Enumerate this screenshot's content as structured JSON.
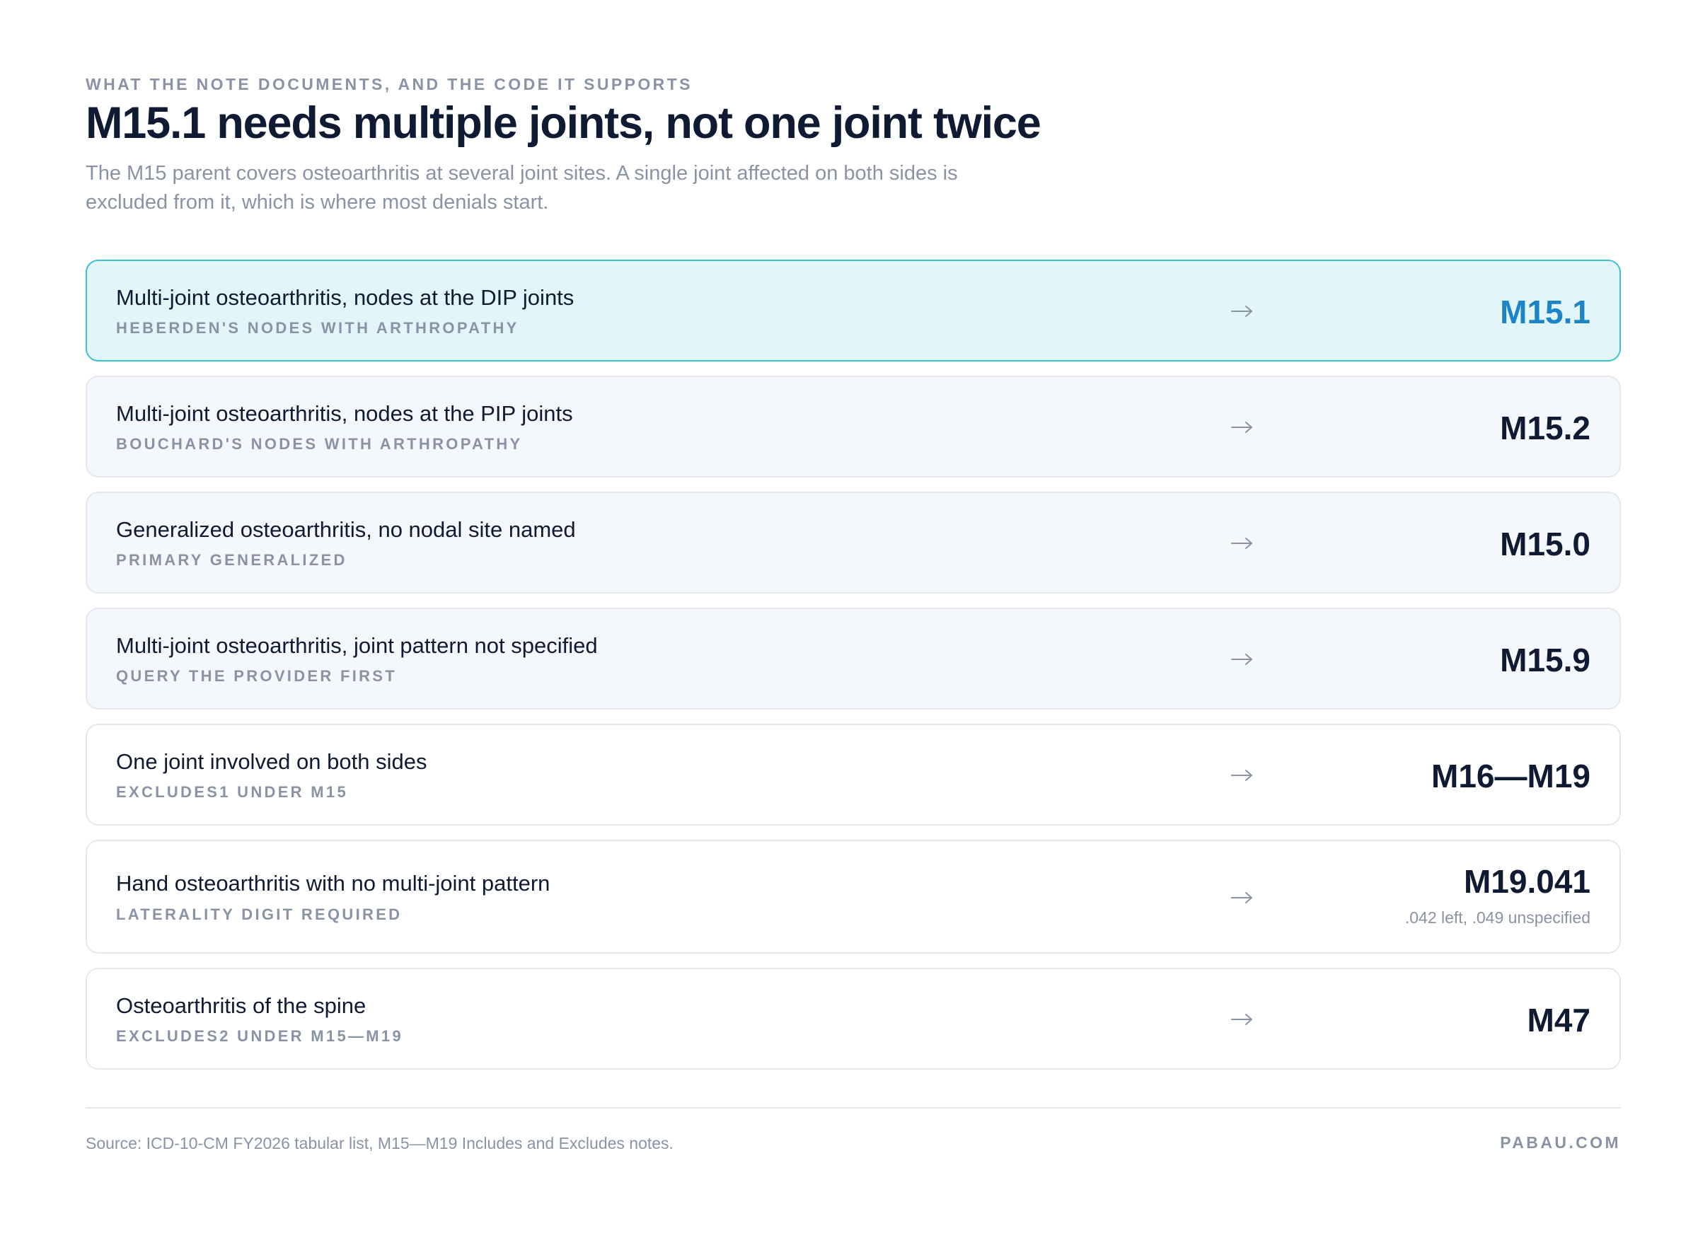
{
  "header": {
    "eyebrow": "WHAT THE NOTE DOCUMENTS, AND THE CODE IT SUPPORTS",
    "title": "M15.1 needs multiple joints, not one joint twice",
    "subtitle": "The M15 parent covers osteoarthritis at several joint sites. A single joint affected on both sides is excluded from it, which is where most denials start."
  },
  "rows": [
    {
      "label": "Multi-joint osteoarthritis, nodes at the DIP joints",
      "sub": "HEBERDEN'S NODES WITH ARTHROPATHY",
      "code": "M15.1",
      "note": "",
      "style": "highlight"
    },
    {
      "label": "Multi-joint osteoarthritis, nodes at the PIP joints",
      "sub": "BOUCHARD'S NODES WITH ARTHROPATHY",
      "code": "M15.2",
      "note": "",
      "style": "tinted"
    },
    {
      "label": "Generalized osteoarthritis, no nodal site named",
      "sub": "PRIMARY GENERALIZED",
      "code": "M15.0",
      "note": "",
      "style": "tinted"
    },
    {
      "label": "Multi-joint osteoarthritis, joint pattern not specified",
      "sub": "QUERY THE PROVIDER FIRST",
      "code": "M15.9",
      "note": "",
      "style": "tinted"
    },
    {
      "label": "One joint involved on both sides",
      "sub": "EXCLUDES1 UNDER M15",
      "code": "M16—M19",
      "note": "",
      "style": "plain"
    },
    {
      "label": "Hand osteoarthritis with no multi-joint pattern",
      "sub": "LATERALITY DIGIT REQUIRED",
      "code": "M19.041",
      "note": ".042 left, .049 unspecified",
      "style": "plain"
    },
    {
      "label": "Osteoarthritis of the spine",
      "sub": "EXCLUDES2 UNDER M15—M19",
      "code": "M47",
      "note": "",
      "style": "plain"
    }
  ],
  "footer": {
    "source": "Source: ICD-10-CM FY2026 tabular list, M15—M19 Includes and Excludes notes.",
    "brand": "PABAU.COM"
  },
  "colors": {
    "highlight_bg": "#e2f6fa",
    "highlight_border": "#3cc1cf",
    "accent_code": "#1b84c9",
    "text": "#0f1b33",
    "muted": "#8a93a5"
  },
  "icons": {
    "row_arrow": "arrow-right-icon"
  }
}
